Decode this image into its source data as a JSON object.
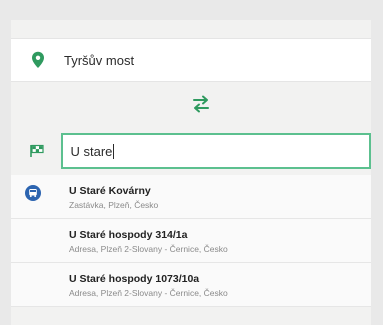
{
  "from": {
    "value": "Tyršův most"
  },
  "to": {
    "value": "U stare"
  },
  "results": [
    {
      "title": "U Staré Kovárny",
      "subtitle": "Zastávka, Plzeň, Česko",
      "icon": "bus-stop-icon"
    },
    {
      "title": "U Staré hospody 314/1a",
      "subtitle": "Adresa, Plzeň 2-Slovany - Černice, Česko",
      "icon": ""
    },
    {
      "title": "U Staré hospody 1073/10a",
      "subtitle": "Adresa, Plzeň 2-Slovany - Černice, Česko",
      "icon": ""
    }
  ],
  "colors": {
    "accent": "#5cc08f",
    "pin": "#2f9a5f",
    "bus_stop": "#2c64b0",
    "text": "#2b2b2b",
    "muted": "#8a8a8a"
  }
}
